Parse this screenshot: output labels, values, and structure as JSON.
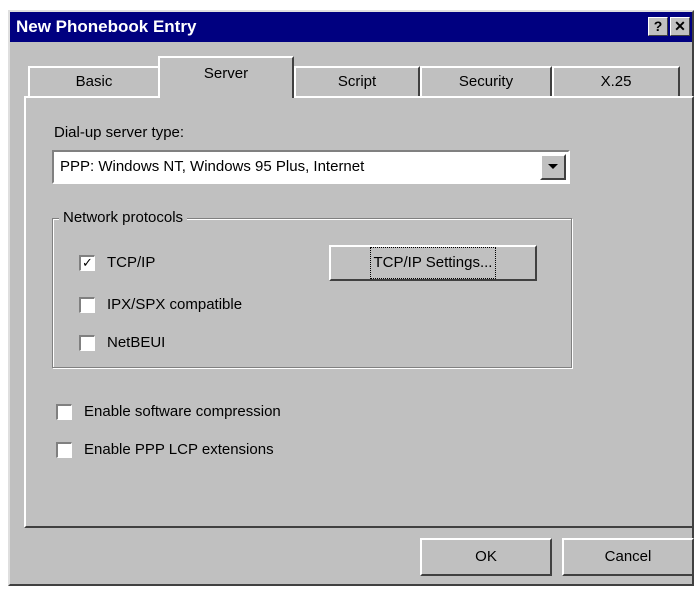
{
  "window": {
    "title": "New Phonebook Entry",
    "help_glyph": "?",
    "close_glyph": "✕"
  },
  "tabs": [
    {
      "label": "Basic",
      "active": false
    },
    {
      "label": "Server",
      "active": true
    },
    {
      "label": "Script",
      "active": false
    },
    {
      "label": "Security",
      "active": false
    },
    {
      "label": "X.25",
      "active": false
    }
  ],
  "server": {
    "type_label": "Dial-up server type:",
    "type_value": "PPP: Windows NT, Windows 95 Plus, Internet",
    "protocols_group_label": "Network protocols",
    "protocols": [
      {
        "label": "TCP/IP",
        "checked": true,
        "check_glyph": "✓"
      },
      {
        "label": "IPX/SPX compatible",
        "checked": false
      },
      {
        "label": "NetBEUI",
        "checked": false
      }
    ],
    "tcpip_settings_button": "TCP/IP Settings...",
    "options": [
      {
        "label": "Enable software compression",
        "checked": false
      },
      {
        "label": "Enable PPP LCP extensions",
        "checked": false
      }
    ]
  },
  "footer": {
    "ok_label": "OK",
    "cancel_label": "Cancel"
  }
}
